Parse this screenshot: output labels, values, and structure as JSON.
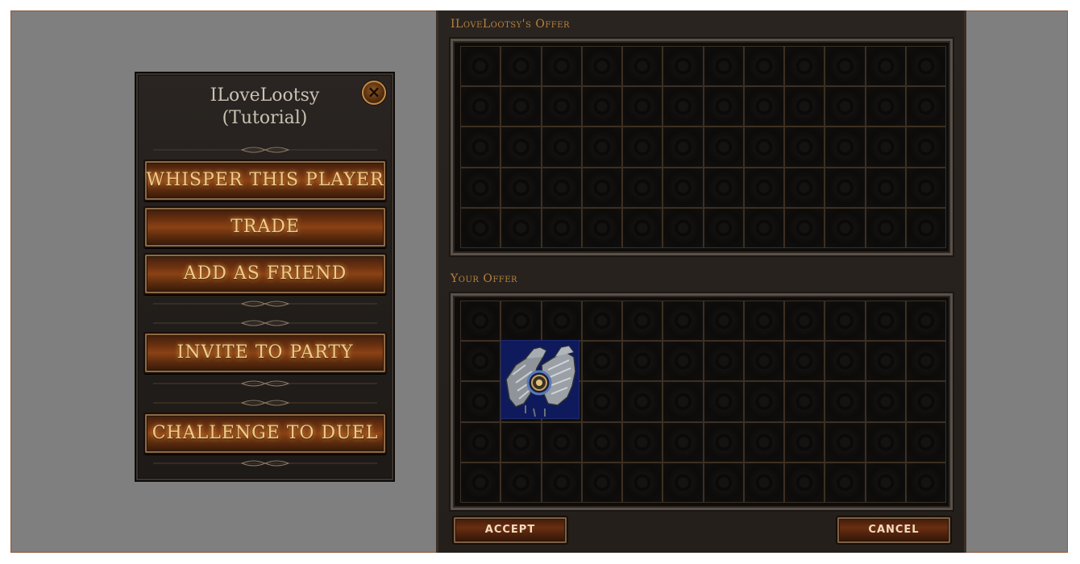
{
  "player_menu": {
    "player_name": "ILoveLootsy",
    "player_subtitle": "(Tutorial)",
    "close_icon": "close-x-icon",
    "buttons": {
      "whisper": "WHISPER THIS PLAYER",
      "trade": "TRADE",
      "add_friend": "ADD AS FRIEND",
      "invite_party": "INVITE TO PARTY",
      "challenge_duel": "CHALLENGE TO DUEL"
    }
  },
  "trade_window": {
    "their_offer_label": "ILoveLootsy's Offer",
    "your_offer_label": "Your Offer",
    "grid": {
      "columns": 12,
      "rows": 5
    },
    "your_offer_items": [
      {
        "name": "gauntlets-icon",
        "column": 2,
        "row": 2,
        "width_cells": 2,
        "height_cells": 2,
        "background": "#0e1a5c"
      }
    ],
    "accept_label": "ACCEPT",
    "cancel_label": "CANCEL"
  },
  "colors": {
    "background": "#7f7f7f",
    "button_text": "#f2c98a",
    "label_gold": "#b8823c"
  }
}
